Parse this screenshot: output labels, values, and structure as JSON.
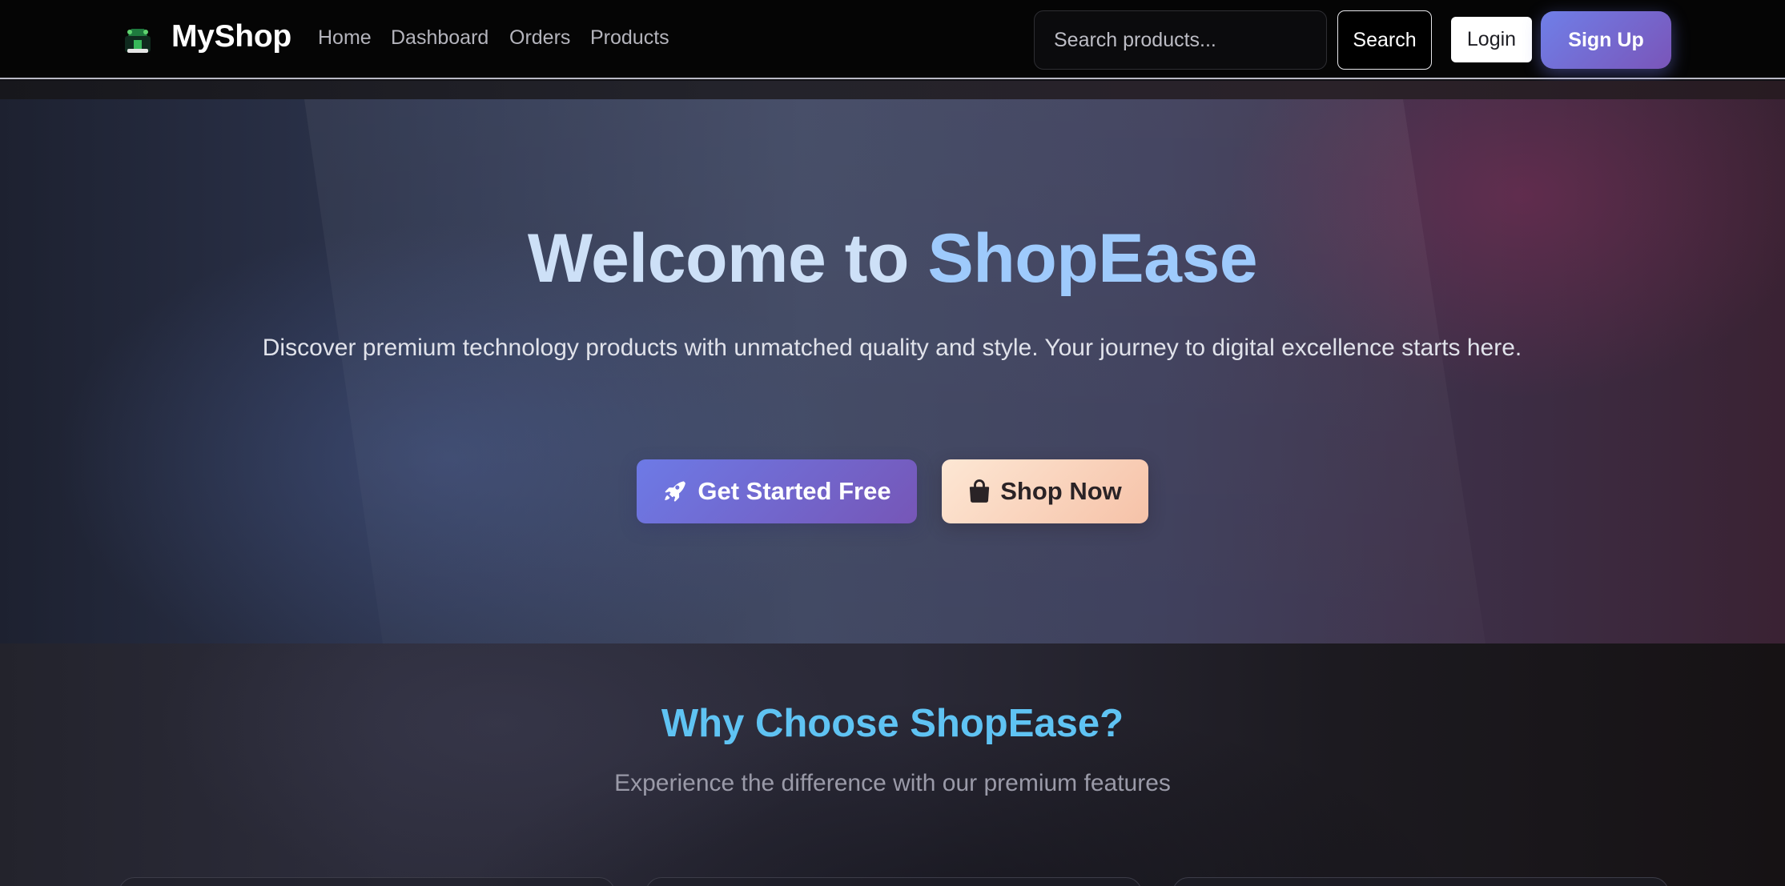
{
  "nav": {
    "brand": "MyShop",
    "links": [
      {
        "label": "Home"
      },
      {
        "label": "Dashboard"
      },
      {
        "label": "Orders"
      },
      {
        "label": "Products"
      }
    ],
    "search": {
      "placeholder": "Search products...",
      "value": "",
      "button_label": "Search"
    },
    "login_label": "Login",
    "signup_label": "Sign Up"
  },
  "hero": {
    "title_part1": "Welcome to",
    "title_part2": "ShopEase",
    "subtitle": "Discover premium technology products with unmatched quality and style. Your journey to digital excellence starts here.",
    "primary_cta": {
      "label": "Get Started Free",
      "icon": "rocket-icon"
    },
    "secondary_cta": {
      "label": "Shop Now",
      "icon": "shopping-bag-icon"
    }
  },
  "features": {
    "title": "Why Choose ShopEase?",
    "subtitle": "Experience the difference with our premium features"
  },
  "colors": {
    "accent_gradient_start": "#6f7fe8",
    "accent_gradient_end": "#7a55b9",
    "shop_button": "#f8d3bd",
    "features_title": "#5fc3f3",
    "hero_title_light": "#cde0f7",
    "hero_title_accent": "#9ecafc"
  }
}
